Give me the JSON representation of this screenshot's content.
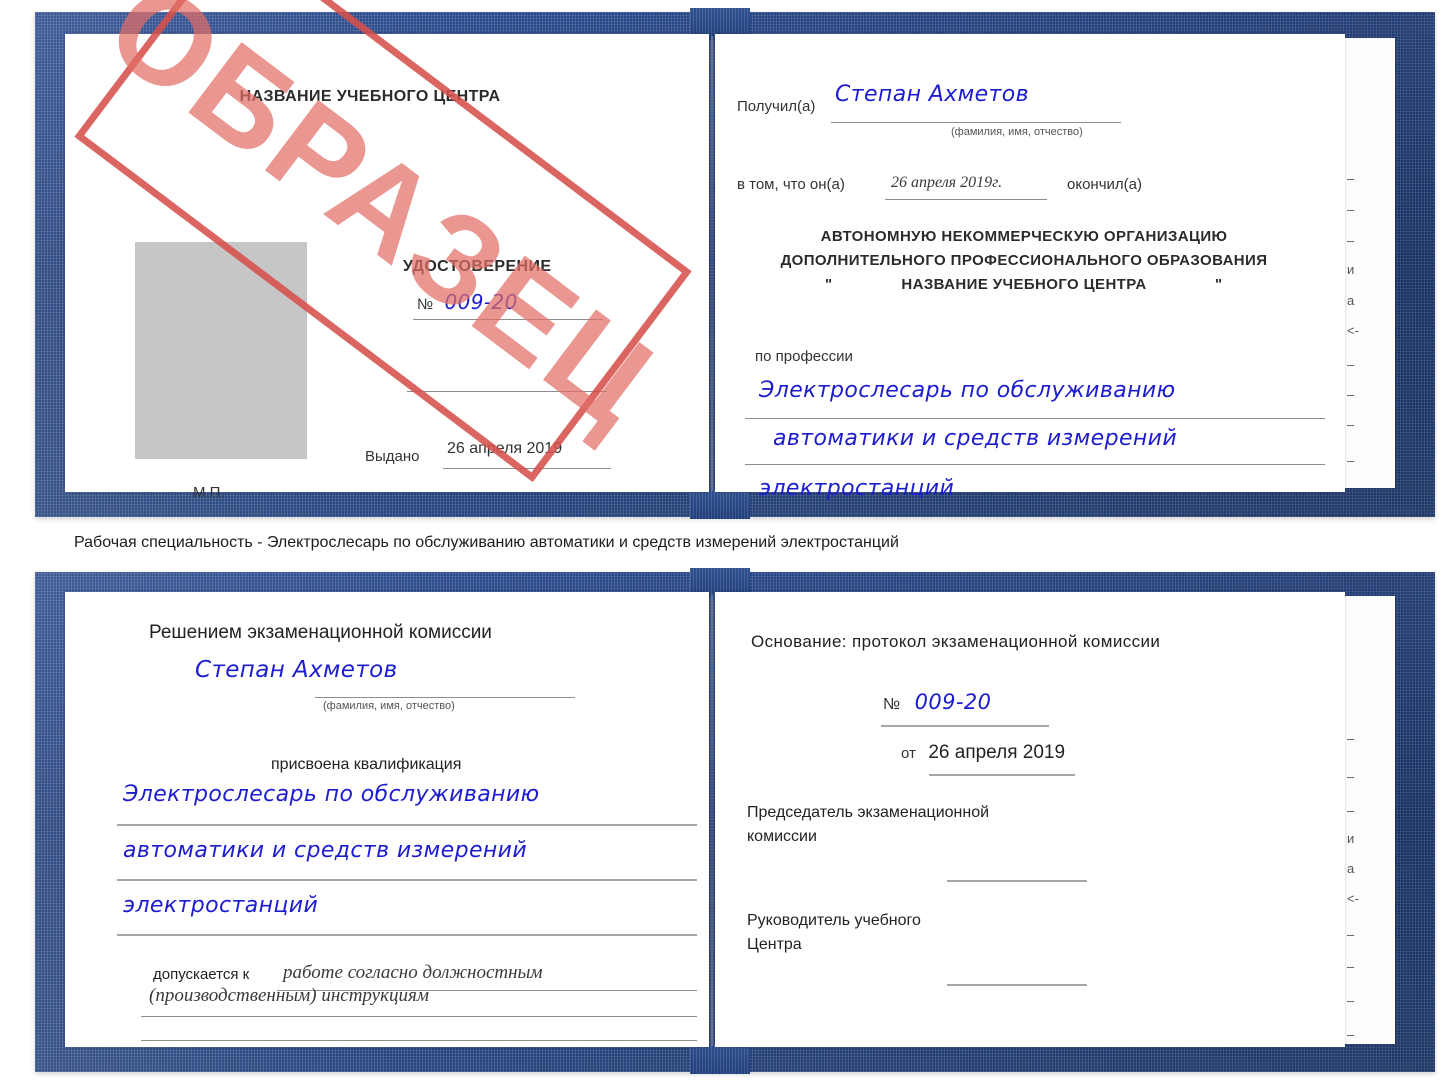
{
  "meta": {
    "stamp_text": "ОБРАЗЕЦ",
    "stamp_color": "#d6504a",
    "cover_color": "#24427f",
    "ink_color": "#1d1dcf"
  },
  "caption": {
    "text": "Рабочая специальность - Электрослесарь по обслуживанию автоматики и средств измерений электростанций"
  },
  "cert_top": {
    "left_page": {
      "center_name": "НАЗВАНИЕ УЧЕБНОГО ЦЕНТРА",
      "doc_title": "УДОСТОВЕРЕНИЕ",
      "number_label": "№",
      "number_value": "009-20",
      "issued_label": "Выдано",
      "issued_value": "26 апреля 2019",
      "seal_label": "М.П.",
      "photo_placeholder": "photo-placeholder"
    },
    "right_page": {
      "received_label": "Получил(а)",
      "received_value": "Степан Ахметов",
      "fio_hint": "(фамилия, имя, отчество)",
      "that_he_label": "в том, что он(а)",
      "finish_date": "26 апреля 2019г.",
      "finished_label": "окончил(а)",
      "org_line1": "АВТОНОМНУЮ НЕКОММЕРЧЕСКУЮ ОРГАНИЗАЦИЮ",
      "org_line2": "ДОПОЛНИТЕЛЬНОГО ПРОФЕССИОНАЛЬНОГО ОБРАЗОВАНИЯ",
      "org_quote_open": "\"",
      "org_line3": "НАЗВАНИЕ УЧЕБНОГО ЦЕНТРА",
      "org_quote_close": "\"",
      "profession_label": "по профессии",
      "profession_line1": "Электрослесарь по обслуживанию",
      "profession_line2": "автоматики и средств измерений",
      "profession_line3": "электростанций",
      "edge_fragments": [
        "–",
        "–",
        "–",
        "и",
        "а",
        "<-",
        "–",
        "–",
        "–",
        "–"
      ]
    }
  },
  "cert_bottom": {
    "left_page": {
      "decision_title": "Решением экзаменационной комиссии",
      "name_value": "Степан Ахметов",
      "fio_hint": "(фамилия, имя, отчество)",
      "qualification_label": "присвоена квалификация",
      "qual_line1": "Электрослесарь по обслуживанию",
      "qual_line2": "автоматики и средств измерений",
      "qual_line3": "электростанций",
      "allowed_label": "допускается к",
      "allowed_value1": "работе согласно должностным",
      "allowed_value2": "(производственным) инструкциям"
    },
    "right_page": {
      "basis_label": "Основание: протокол экзаменационной комиссии",
      "number_label": "№",
      "number_value": "009-20",
      "date_label": "от",
      "date_value": "26 апреля 2019",
      "chairman_line1": "Председатель экзаменационной",
      "chairman_line2": "комиссии",
      "head_line1": "Руководитель учебного",
      "head_line2": "Центра",
      "edge_fragments": [
        "–",
        "–",
        "–",
        "и",
        "а",
        "<-",
        "–",
        "–",
        "–",
        "–"
      ]
    }
  }
}
